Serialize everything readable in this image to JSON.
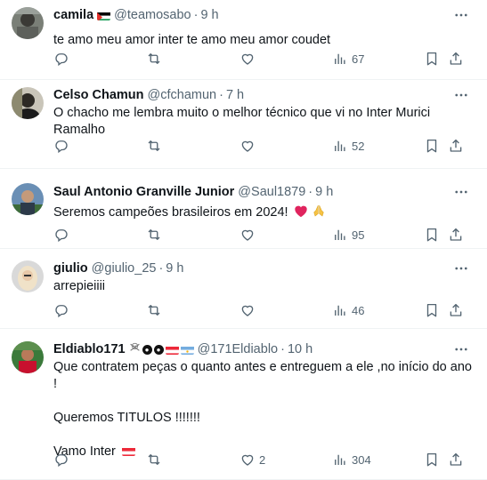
{
  "tweets": [
    {
      "name": "camila",
      "handle": "@teamosabo",
      "time": "9 h",
      "lines": [
        "te amo meu amor inter te amo meu amor coudet"
      ],
      "stats": {
        "replies": "",
        "retweets": "",
        "likes": "",
        "views": "67"
      }
    },
    {
      "name": "Celso Chamun",
      "handle": "@cfchamun",
      "time": "7 h",
      "lines": [
        "O chacho me lembra muito o melhor técnico que vi no Inter Murici",
        "Ramalho"
      ],
      "stats": {
        "replies": "",
        "retweets": "",
        "likes": "",
        "views": "52"
      }
    },
    {
      "name": "Saul Antonio Granville Junior",
      "handle": "@Saul1879",
      "time": "9 h",
      "lines": [
        "Seremos campeões brasileiros em 2024!"
      ],
      "emoji_after": [
        "red-heart",
        "folded-hands"
      ],
      "stats": {
        "replies": "",
        "retweets": "",
        "likes": "",
        "views": "95"
      }
    },
    {
      "name": "giulio",
      "handle": "@giulio_25",
      "time": "9 h",
      "lines": [
        "arrepieiiii"
      ],
      "stats": {
        "replies": "",
        "retweets": "",
        "likes": "",
        "views": "46"
      }
    },
    {
      "name": "Eldiablo171",
      "handle": "@171Eldiablo",
      "time": "10 h",
      "lines": [
        "Que contratem peças o quanto antes e entreguem a ele ,no início do ano !",
        "",
        "Queremos TITULOS !!!!!!!",
        "",
        "Vamo Inter"
      ],
      "stats": {
        "replies": "",
        "retweets": "",
        "likes": "2",
        "views": "304"
      }
    }
  ],
  "separator": "·",
  "icons": {
    "more": "more-horizontal-icon",
    "reply": "reply-icon",
    "retweet": "retweet-icon",
    "like": "like-icon",
    "views": "views-icon",
    "bookmark": "bookmark-icon",
    "share": "share-icon"
  },
  "colors": {
    "text": "#0f1419",
    "muted": "#536471",
    "border": "#eff3f4",
    "heart": "#e0245e"
  }
}
